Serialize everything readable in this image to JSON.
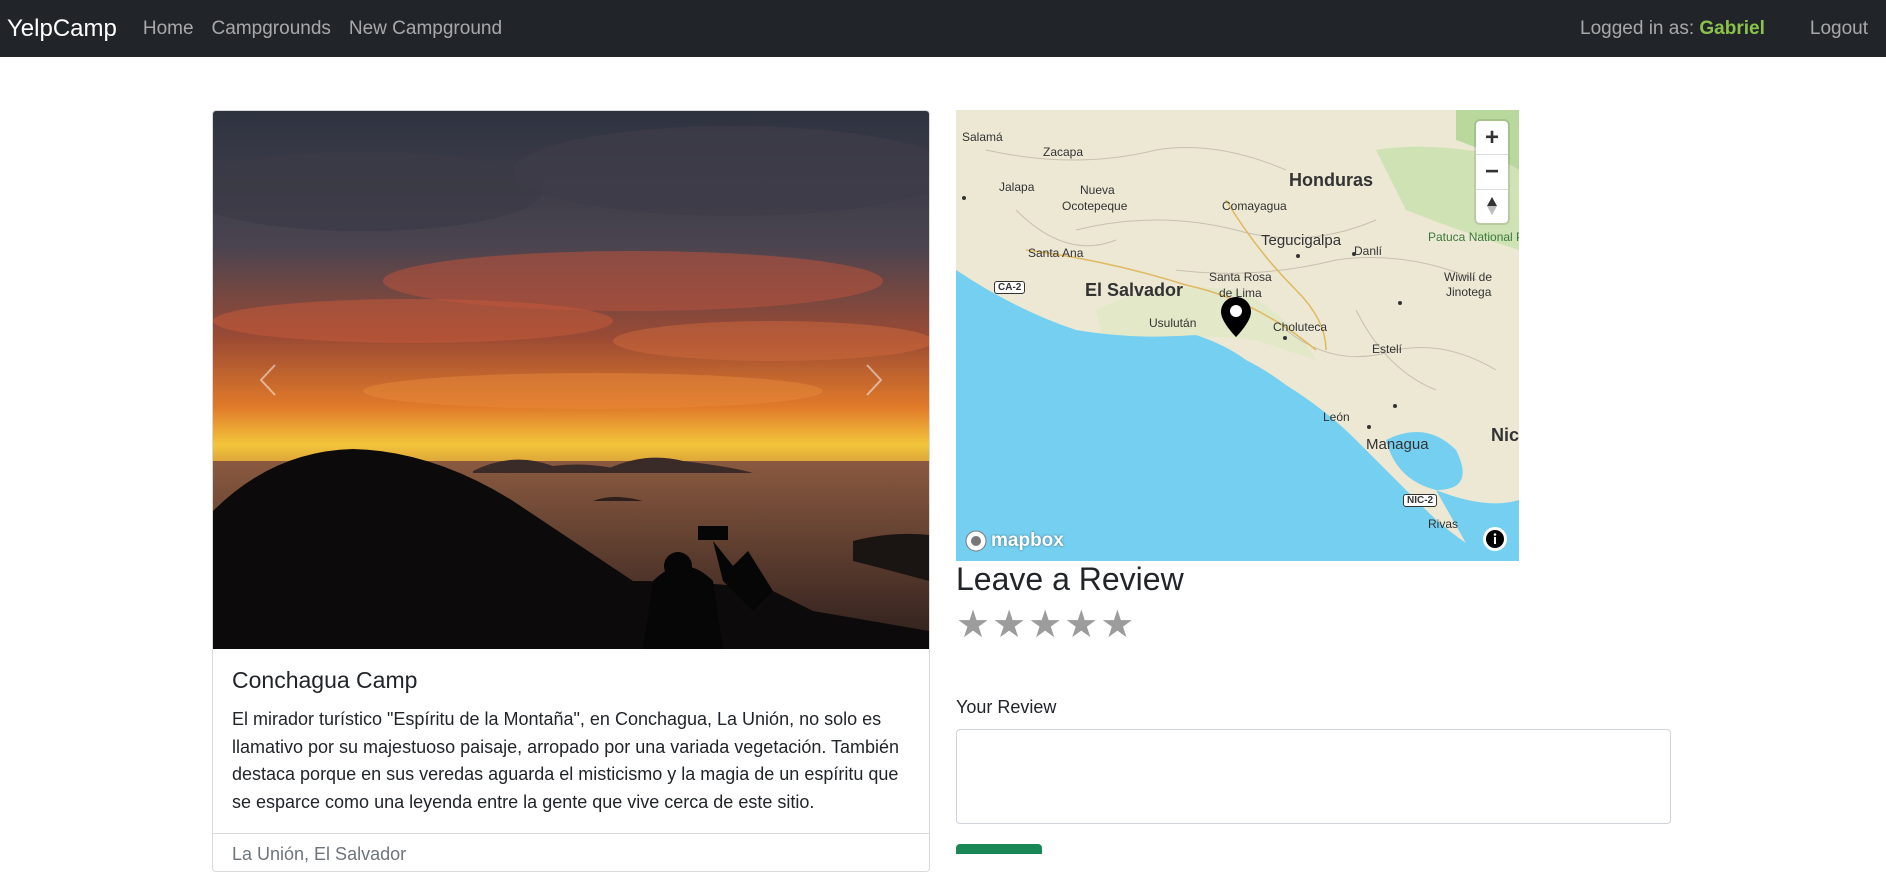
{
  "navbar": {
    "brand": "YelpCamp",
    "links": [
      "Home",
      "Campgrounds",
      "New Campground"
    ],
    "logged_in_prefix": "Logged in as:",
    "username": "Gabriel",
    "logout": "Logout"
  },
  "campground": {
    "title": "Conchagua Camp",
    "description": "El mirador turístico \"Espíritu de la Montaña\", en Conchagua, La Unión, no solo es llamativo por su majestuoso paisaje, arropado por una variada vegetación. También destaca porque en sus veredas aguarda el misticismo y la magia de un espíritu que se esparce como una leyenda entre la gente que vive cerca de este sitio.",
    "location": "La Unión, El Salvador"
  },
  "map": {
    "attribution": "mapbox",
    "zoom_in": "+",
    "zoom_out": "−",
    "labels": {
      "honduras": "Honduras",
      "el_salvador": "El Salvador",
      "nic": "Nic",
      "salama": "Salamá",
      "zacapa": "Zacapa",
      "jalapa": "Jalapa",
      "nueva": "Nueva",
      "ocotepeque": "Ocotepeque",
      "comayagua": "Comayagua",
      "tegucigalpa": "Tegucigalpa",
      "danli": "Danlí",
      "santa_ana": "Santa Ana",
      "santa_rosa": "Santa Rosa",
      "de_lima": "de Lima",
      "usulutan": "Usulután",
      "choluteca": "Choluteca",
      "wiwili": "Wiwilí de",
      "jinotega": "Jinotega",
      "esteli": "Estelí",
      "leon": "León",
      "managua": "Managua",
      "rivas": "Rivas",
      "patuca": "Patuca National P",
      "ca2": "CA-2",
      "nic2": "NIC-2"
    }
  },
  "review": {
    "heading": "Leave a Review",
    "stars": [
      "★",
      "★",
      "★",
      "★",
      "★"
    ],
    "label": "Your Review",
    "textarea_value": ""
  },
  "colors": {
    "navbar_bg": "#212529",
    "username": "#8bc34a",
    "water": "#75cff0",
    "star_inactive": "#9c9c9c",
    "submit": "#198754"
  }
}
